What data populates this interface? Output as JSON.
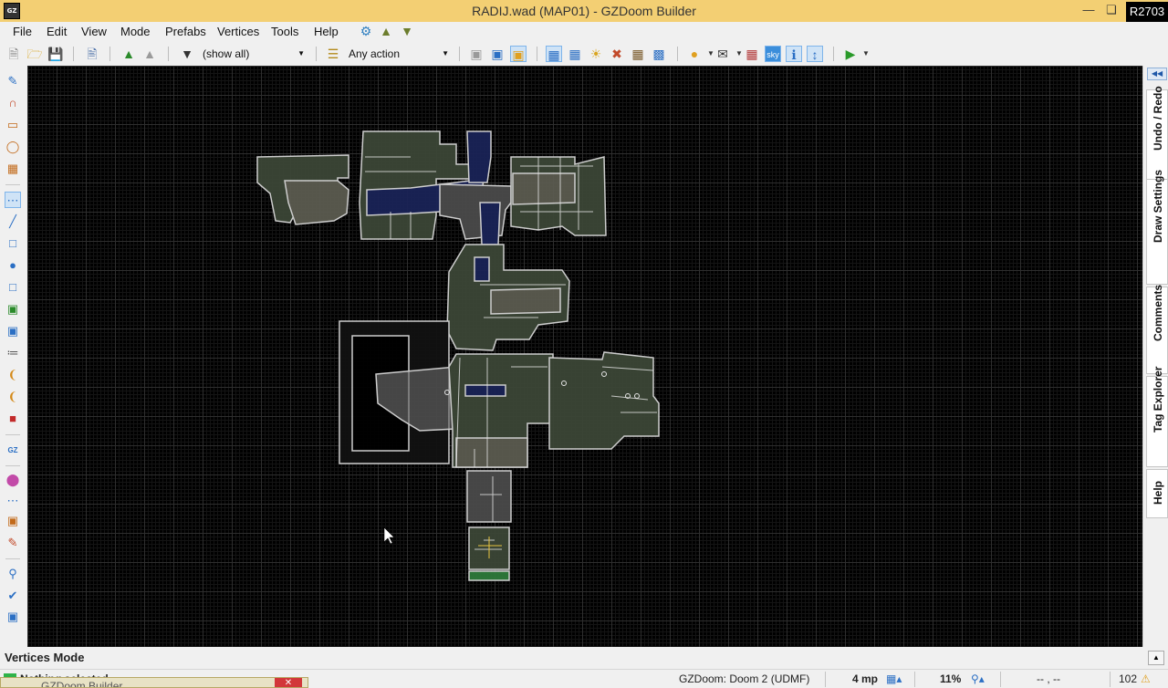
{
  "window": {
    "app_icon_text": "GZ",
    "title": "RADIJ.wad (MAP01) - GZDoom Builder",
    "revision": "R2703"
  },
  "menu": [
    "File",
    "Edit",
    "View",
    "Mode",
    "Prefabs",
    "Vertices",
    "Tools",
    "Help"
  ],
  "toolbar": {
    "filter_value": "(show all)",
    "action_value": "Any action"
  },
  "right_dock": {
    "tabs": [
      "Undo / Redo",
      "Draw Settings",
      "Comments",
      "Tag Explorer",
      "Help"
    ]
  },
  "mode_label": "Vertices Mode",
  "status": {
    "text": "Nothing selected",
    "engine": "GZDoom: Doom 2 (UDMF)",
    "grid": "4 mp",
    "zoom": "11%",
    "coords": "-- , --",
    "warnings": "102"
  },
  "taskbar_popup": {
    "text": "GZDoom Builder"
  },
  "colors": {
    "title_bar": "#f3cf73",
    "map_background": "#000000",
    "linedef": "#d8d8d8",
    "sector_fill_green": "#3b4636",
    "sector_fill_blue": "#1a2357",
    "status_icon": "#2fb34a"
  },
  "icons": {
    "toolbar": [
      "new-map-icon",
      "open-map-icon",
      "save-map-icon",
      "script-editor-icon",
      "thing-filter-icon",
      "thing-filter-disabled-icon",
      "filter-icon",
      "action-icon",
      "copy-icon",
      "paste-icon",
      "paste-special-icon",
      "grid-icon",
      "grid-settings-icon",
      "dynamic-light-icon",
      "model-icon",
      "texture-icon",
      "sector-effects-icon",
      "light-bulb-icon",
      "envelope-icon",
      "map-analysis-icon",
      "sky-icon",
      "info-icon",
      "height-icon",
      "test-map-icon"
    ],
    "left": [
      "linedef-draw-icon",
      "curve-icon",
      "rectangle-draw-icon",
      "ellipse-draw-icon",
      "grid-draw-icon",
      "vertices-mode-icon",
      "linedefs-mode-icon",
      "sectors-mode-icon",
      "things-mode-icon",
      "make-sector-icon",
      "bridge-icon",
      "sector-3d-icon",
      "stair-icon",
      "sound-environment-icon",
      "sound-propagation-icon",
      "thing-icon",
      "gz-icon",
      "color-picker-icon",
      "vertices-selection-icon",
      "fit-select-icon",
      "draw-line-icon",
      "zoom-icon",
      "check-icon",
      "image-icon"
    ]
  }
}
